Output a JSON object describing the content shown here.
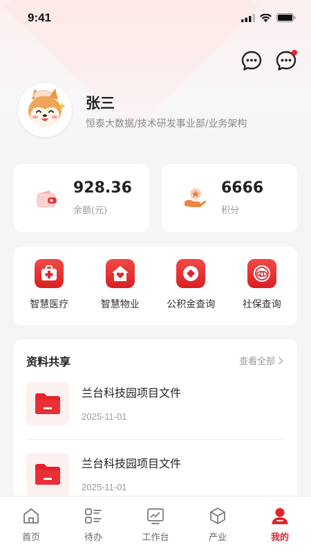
{
  "status": {
    "time": "9:41"
  },
  "header": {
    "actions": [
      {
        "name": "message-icon",
        "badge": false
      },
      {
        "name": "message-icon",
        "badge": true
      }
    ]
  },
  "profile": {
    "name": "张三",
    "department": "恒泰大数据/技术研发事业部/业务架构",
    "avatar_icon": "shiba-dog-avatar"
  },
  "stats": [
    {
      "value": "928.36",
      "label": "余额(元)",
      "icon": "wallet-icon"
    },
    {
      "value": "6666",
      "label": "积分",
      "icon": "points-hand-icon"
    }
  ],
  "services": [
    {
      "label": "智慧医疗",
      "icon": "medical-kit-icon"
    },
    {
      "label": "智慧物业",
      "icon": "home-heart-icon"
    },
    {
      "label": "公积金查询",
      "icon": "fund-diamond-icon"
    },
    {
      "label": "社保查询",
      "icon": "social-security-icon"
    }
  ],
  "files": {
    "title": "资料共享",
    "view_all": "查看全部",
    "items": [
      {
        "name": "兰台科技园项目文件",
        "date": "2025-11-01",
        "icon": "folder-icon"
      },
      {
        "name": "兰台科技园项目文件",
        "date": "2025-11-01",
        "icon": "folder-icon"
      }
    ]
  },
  "tabbar": {
    "tabs": [
      {
        "label": "首页",
        "icon": "home-icon",
        "active": false
      },
      {
        "label": "待办",
        "icon": "todo-list-icon",
        "active": false
      },
      {
        "label": "工作台",
        "icon": "chart-monitor-icon",
        "active": false
      },
      {
        "label": "产业",
        "icon": "cube-icon",
        "active": false
      },
      {
        "label": "我的",
        "icon": "user-icon",
        "active": true
      }
    ]
  },
  "colors": {
    "accent": "#e0262b",
    "background": "#f5f5f6"
  }
}
